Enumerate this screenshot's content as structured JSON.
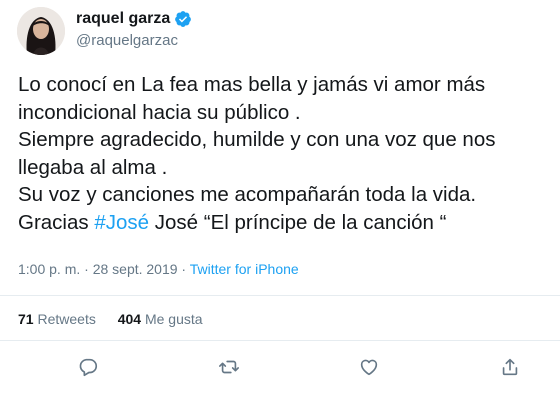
{
  "author": {
    "name": "raquel garza",
    "handle": "@raquelgarzac",
    "verified": true
  },
  "tweet": {
    "lines": [
      "Lo conocí en La fea mas bella y jamás vi amor más",
      "incondicional hacia su público .",
      "Siempre agradecido, humilde y con una voz que nos",
      "llegaba al alma .",
      "Su voz y canciones me acompañarán toda la vida."
    ],
    "last_line_prefix": "Gracias ",
    "hashtag": "#José",
    "last_line_suffix": " José “El príncipe de la canción “"
  },
  "meta": {
    "timestamp": "1:00 p. m. · 28 sept. 2019 · ",
    "source": "Twitter for iPhone"
  },
  "stats": {
    "retweets_count": "71",
    "retweets_label": "Retweets",
    "likes_count": "404",
    "likes_label": "Me gusta"
  },
  "actions": [
    "reply-icon",
    "retweet-icon",
    "like-icon",
    "share-icon"
  ],
  "colors": {
    "accent": "#1da1f2",
    "text": "#14171a",
    "muted": "#657786",
    "divider": "#e6ecf0"
  }
}
